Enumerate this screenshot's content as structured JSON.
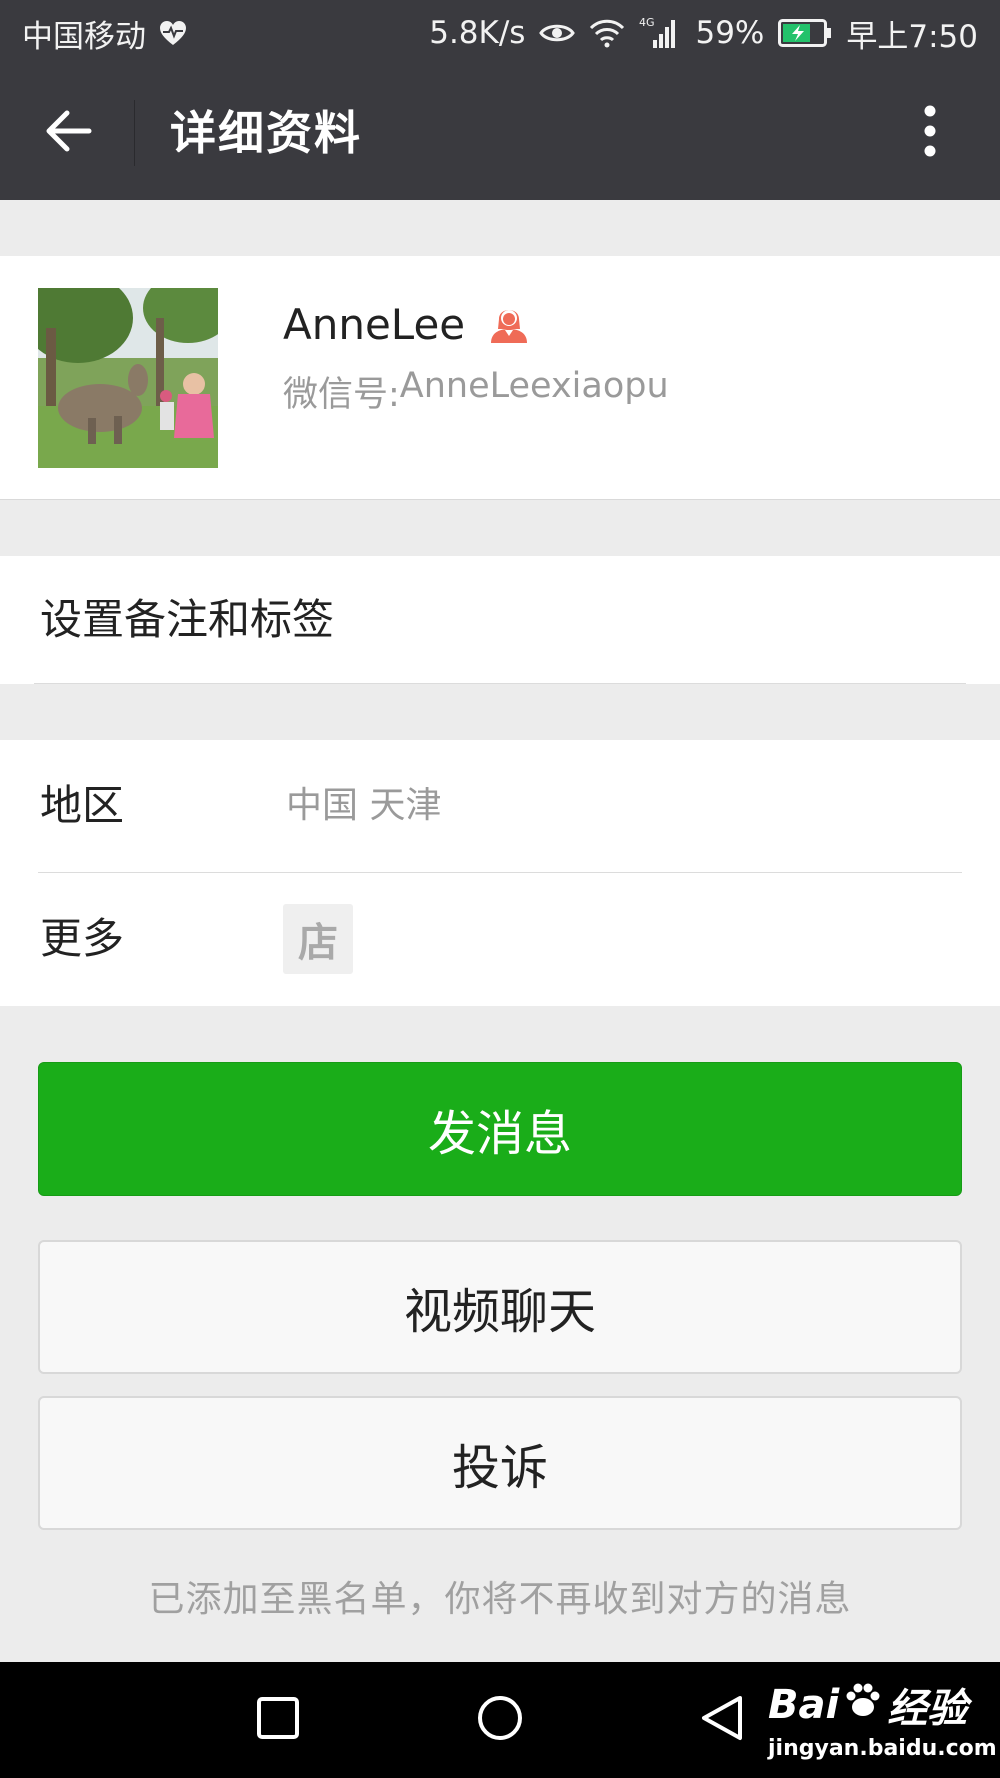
{
  "status_bar": {
    "carrier": "中国移动",
    "speed": "5.8K/s",
    "network": "4G",
    "battery": "59%",
    "time": "早上7:50",
    "battery_color": "#23c26b"
  },
  "title_bar": {
    "title": "详细资料",
    "back_icon": "arrow-left-icon",
    "more_icon": "more-vertical-icon"
  },
  "profile": {
    "name": "AnneLee",
    "gender_icon": "female-user-icon",
    "wxid_label": "微信号: ",
    "wxid_value": "AnneLeexiaopu"
  },
  "remark": {
    "label": "设置备注和标签"
  },
  "info": {
    "region_label": "地区",
    "region_value": "中国  天津",
    "more_label": "更多",
    "shop_icon_char": "店"
  },
  "actions": {
    "send_message": "发消息",
    "video_chat": "视频聊天",
    "report": "投诉"
  },
  "blacklist_note": "已添加至黑名单，你将不再收到对方的消息",
  "watermark": {
    "brand_prefix": "Bai",
    "brand_suffix": "经验",
    "url": "jingyan.baidu.com"
  },
  "colors": {
    "primary_green": "#1aad19",
    "header_bg": "#3a3a3f",
    "gender_icon": "#ef6b57"
  }
}
